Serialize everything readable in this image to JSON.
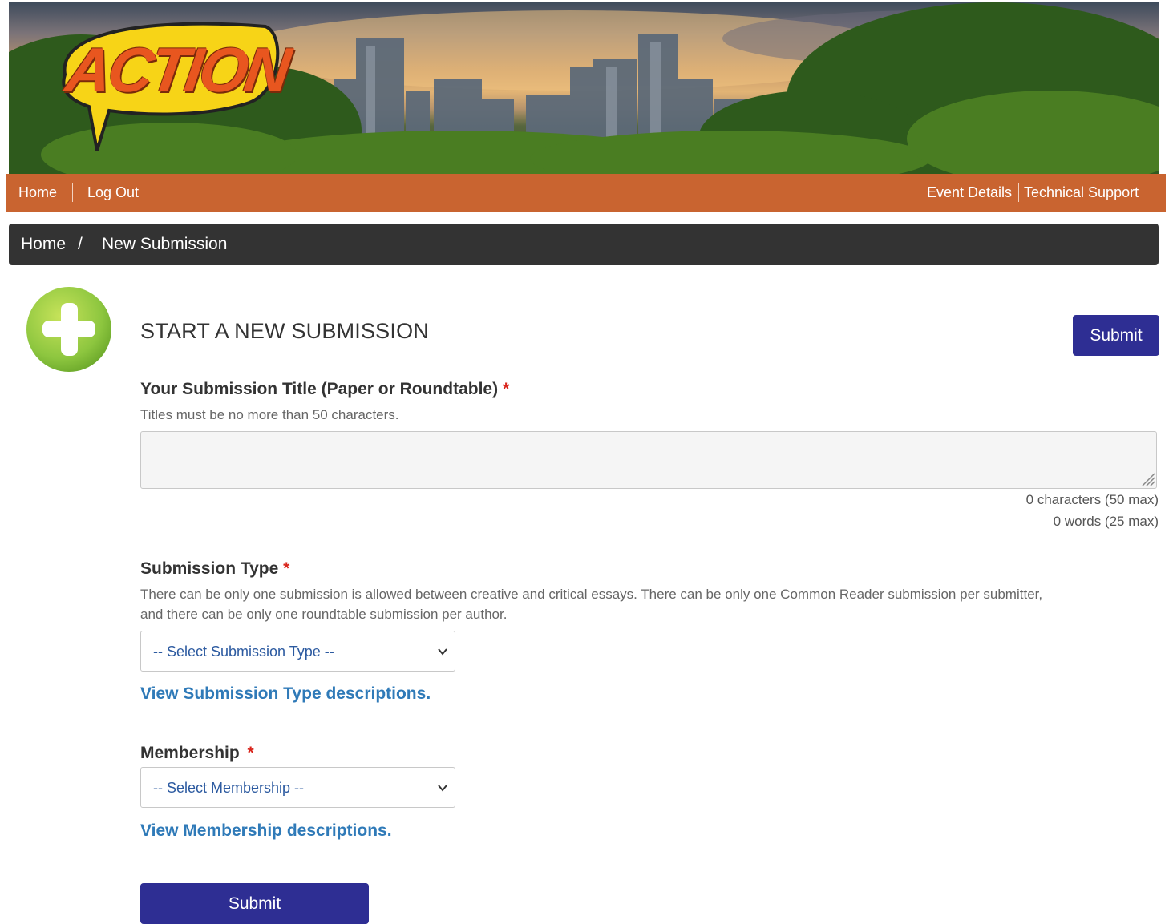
{
  "banner": {
    "logo_text": "ACTION"
  },
  "topnav": {
    "home": "Home",
    "logout": "Log Out",
    "event_details": "Event Details",
    "tech_support": "Technical Support"
  },
  "breadcrumb": {
    "home": "Home",
    "separator": "/",
    "current": "New Submission"
  },
  "page": {
    "title": "START A NEW SUBMISSION",
    "submit_label": "Submit"
  },
  "title_field": {
    "label": "Your Submission Title (Paper or Roundtable)",
    "required_mark": "*",
    "help": "Titles must be no more than 50 characters.",
    "value": "",
    "char_counter": "0 characters (50 max)",
    "word_counter": "0 words (25 max)"
  },
  "submission_type": {
    "label": "Submission Type",
    "required_mark": "*",
    "help_line1": "There can be only one submission is allowed between creative and critical essays. There can be only one Common Reader submission per submitter,",
    "help_line2": "and there can be only one roundtable submission per author.",
    "selected": "-- Select Submission Type --",
    "link": "View Submission Type descriptions."
  },
  "membership": {
    "label": "Membership",
    "required_mark": "*",
    "selected": "-- Select Membership --",
    "link": "View Membership descriptions."
  },
  "colors": {
    "nav_orange": "#c96430",
    "breadcrumb_dark": "#333333",
    "button_blue": "#2e2e93",
    "link_blue": "#2f7ab8",
    "required_red": "#d9251c",
    "plus_green": "#8dc63f"
  }
}
